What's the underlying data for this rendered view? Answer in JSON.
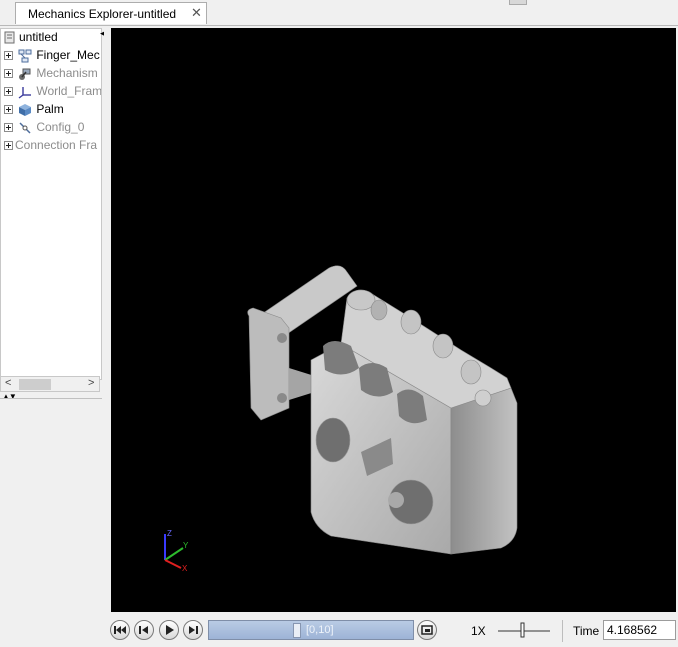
{
  "tab": {
    "title": "Mechanics Explorer-untitled",
    "close_symbol": "✕"
  },
  "tree": {
    "root_label": "untitled",
    "items": [
      {
        "label": "Finger_Mec",
        "icon": "block-diagram-icon",
        "dimmed": false
      },
      {
        "label": "Mechanism",
        "icon": "mechanism-icon",
        "dimmed": true
      },
      {
        "label": "World_Fram",
        "icon": "frame-axes-icon",
        "dimmed": true
      },
      {
        "label": "Palm",
        "icon": "solid-cube-icon",
        "dimmed": false
      },
      {
        "label": "Config_0",
        "icon": "config-icon",
        "dimmed": true
      },
      {
        "label": "Connection Fra",
        "icon": "none",
        "dimmed": true
      }
    ]
  },
  "scrollbar": {
    "left_arrow": "<",
    "right_arrow": ">"
  },
  "viewport": {
    "background": "#000000",
    "triad": {
      "x_label": "X",
      "y_label": "Y",
      "z_label": "Z"
    }
  },
  "toolbar": {
    "timeline_range": "[0,10]",
    "timeline_progress": 0.43,
    "speed_label": "1X",
    "time_label": "Time",
    "time_value": "4.168562"
  },
  "colors": {
    "timeline": "#9db3d6",
    "model": "#c4c4c4"
  }
}
